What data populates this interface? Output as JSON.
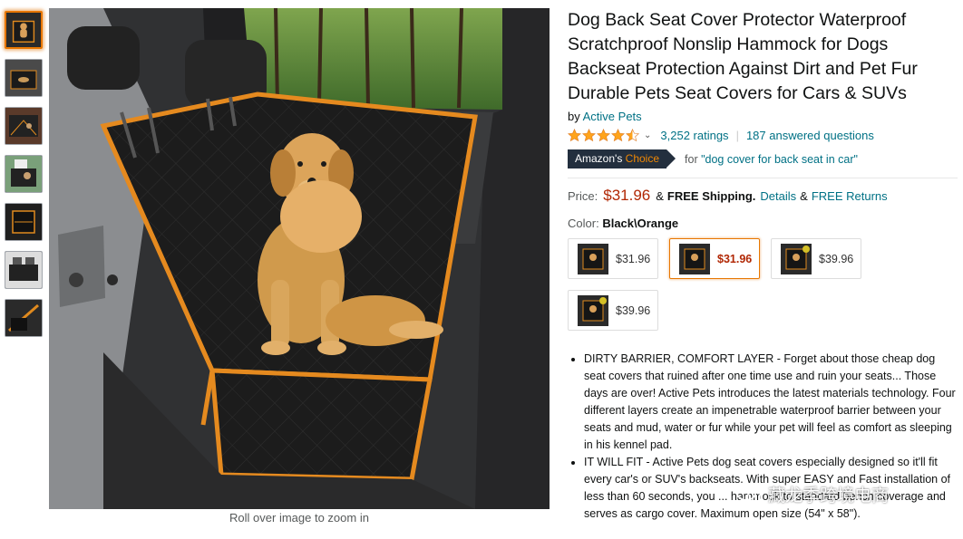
{
  "thumbnails": [
    {
      "name": "thumbnail-1",
      "active": true
    },
    {
      "name": "thumbnail-2",
      "active": false
    },
    {
      "name": "thumbnail-3",
      "active": false
    },
    {
      "name": "thumbnail-4",
      "active": false
    },
    {
      "name": "thumbnail-5",
      "active": false
    },
    {
      "name": "thumbnail-6",
      "active": false
    },
    {
      "name": "thumbnail-7",
      "active": false
    }
  ],
  "main_image": {
    "zoom_hint": "Roll over image to zoom in"
  },
  "product": {
    "title": "Dog Back Seat Cover Protector Waterproof Scratchproof Nonslip Hammock for Dogs Backseat Protection Against Dirt and Pet Fur Durable Pets Seat Covers for Cars & SUVs",
    "by_label": "by",
    "brand": "Active Pets",
    "rating_stars": 4.5,
    "ratings_count": "3,252 ratings",
    "answered": "187 answered questions",
    "badge_prefix": "Amazon's",
    "badge_suffix": "Choice",
    "for_label": "for",
    "for_query": "\"dog cover for back seat in car\"",
    "price_label": "Price:",
    "price": "$31.96",
    "price_amp": "&",
    "free_shipping": "FREE Shipping.",
    "details_link": "Details",
    "amp2": "&",
    "free_returns": "FREE Returns",
    "color_label": "Color:",
    "color_value": "Black\\Orange",
    "swatches": [
      {
        "price": "$31.96",
        "selected": false
      },
      {
        "price": "$31.96",
        "selected": true
      },
      {
        "price": "$39.96",
        "selected": false
      },
      {
        "price": "$39.96",
        "selected": false
      }
    ],
    "bullets": [
      "DIRTY BARRIER, COMFORT LAYER - Forget about those cheap dog seat covers that ruined after one time use and ruin your seats... Those days are over! Active Pets introduces the latest materials technology. Four different layers create an impenetrable waterproof barrier between your seats and mud, water or fur while your pet will feel as comfort as sleeping in his kennel pad.",
      "IT WILL FIT - Active Pets dog seat covers especially designed so it'll fit every car's or SUV's backseats. With super EASY and Fast installation of less than 60 seconds, you ... hammock to standard bench coverage and serves as cargo cover. Maximum open size (54\" x 58\")."
    ]
  },
  "watermark": {
    "text": "藏龙季跨境电商",
    "icon": "wechat-icon"
  },
  "colors": {
    "link": "#007185",
    "price": "#b12704",
    "star": "#ffa41c",
    "badge_bg": "#232f3e",
    "badge_accent": "#f08804",
    "selected_border": "#e77600"
  }
}
